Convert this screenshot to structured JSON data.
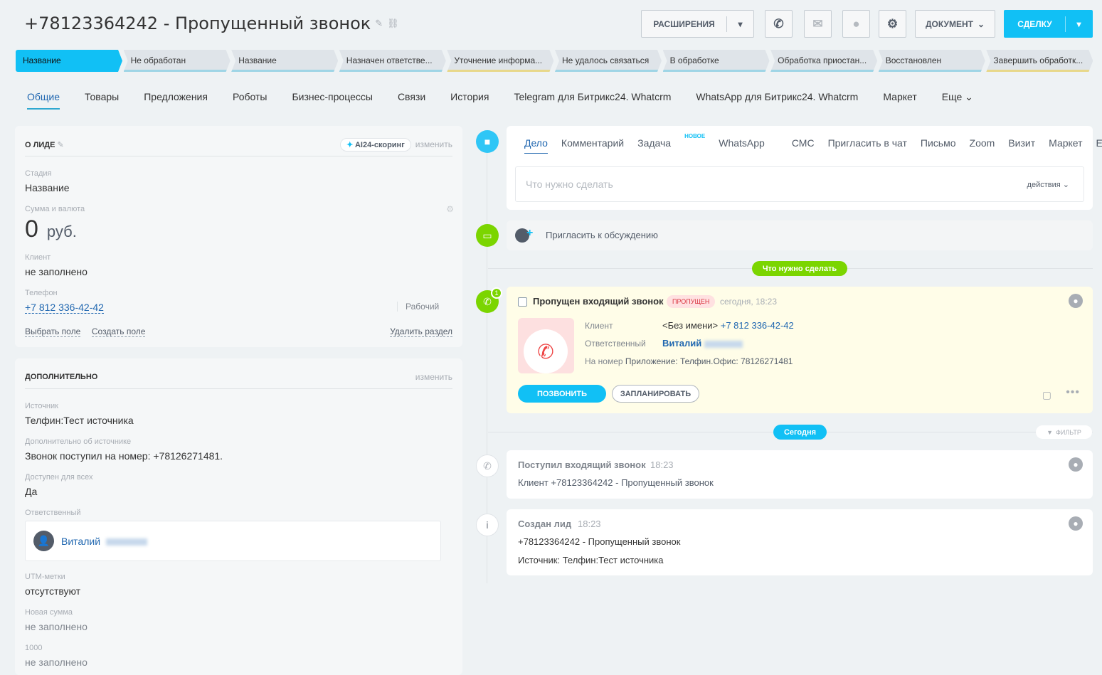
{
  "header": {
    "title": "+78123364242 - Пропущенный звонок",
    "extensions_label": "РАСШИРЕНИЯ",
    "document_label": "ДОКУМЕНТ",
    "create_label": "СДЕЛКУ",
    "accent": "#11c0f5"
  },
  "stages": [
    "Название",
    "Не обработан",
    "Название",
    "Назначен ответстве...",
    "Уточнение информа...",
    "Не удалось связаться",
    "В обработке",
    "Обработка приостан...",
    "Восстановлен",
    "Завершить обработк..."
  ],
  "tabs": [
    "Общие",
    "Товары",
    "Предложения",
    "Роботы",
    "Бизнес-процессы",
    "Связи",
    "История",
    "Telegram для Битрикс24. Whatcrm",
    "WhatsApp для Битрикс24. Whatcrm",
    "Маркет",
    "Еще"
  ],
  "about": {
    "title": "О ЛИДЕ",
    "ai_label": "AI24-скоринг",
    "edit_label": "изменить",
    "stage_label": "Стадия",
    "stage_value": "Название",
    "amount_label": "Сумма и валюта",
    "amount_value": "0",
    "amount_currency": "руб.",
    "client_label": "Клиент",
    "client_value": "не заполнено",
    "phone_label": "Телефон",
    "phone_value": "+7 812 336-42-42",
    "phone_type": "Рабочий",
    "select_field": "Выбрать поле",
    "create_field": "Создать поле",
    "delete_section": "Удалить раздел"
  },
  "extra": {
    "title": "ДОПОЛНИТЕЛЬНО",
    "edit_label": "изменить",
    "source_label": "Источник",
    "source_value": "Телфин:Тест источника",
    "source_more_label": "Дополнительно об источнике",
    "source_more_value": "Звонок поступил на номер: +78126271481.",
    "available_label": "Доступен для всех",
    "available_value": "Да",
    "responsible_label": "Ответственный",
    "responsible_name": "Виталий",
    "utm_label": "UTM-метки",
    "utm_value": "отсутствуют",
    "new_sum_label": "Новая сумма",
    "new_sum_value": "не заполнено",
    "f1000_label": "1000",
    "f1000_value": "не заполнено"
  },
  "activity": {
    "tabs": [
      "Дело",
      "Комментарий",
      "Задача",
      "WhatsApp",
      "СМС",
      "Пригласить в чат",
      "Письмо",
      "Zoom",
      "Визит",
      "Маркет",
      "Еще"
    ],
    "new_tag": "НОВОЕ",
    "placeholder": "Что нужно сделать",
    "actions_label": "действия"
  },
  "invite_label": "Пригласить к обсуждению",
  "todo_pill": "Что нужно сделать",
  "missed_call": {
    "count": "1",
    "title": "Пропущен входящий звонок",
    "badge": "ПРОПУЩЕН",
    "time": "сегодня, 18:23",
    "client_label": "Клиент",
    "client_name": "<Без имени>",
    "client_phone": "+7 812 336-42-42",
    "responsible_label": "Ответственный",
    "responsible_name": "Виталий",
    "number_label": "На номер",
    "number_value": "Приложение: Телфин.Офис: 78126271481",
    "call_button": "ПОЗВОНИТЬ",
    "plan_button": "ЗАПЛАНИРОВАТЬ"
  },
  "today_pill": "Сегодня",
  "filter_label": "ФИЛЬТР",
  "incoming": {
    "title": "Поступил входящий звонок",
    "time": "18:23",
    "text": "Клиент +78123364242 - Пропущенный звонок"
  },
  "created": {
    "title": "Создан лид",
    "time": "18:23",
    "line1": "+78123364242 - Пропущенный звонок",
    "line2": "Источник: Телфин:Тест источника"
  }
}
